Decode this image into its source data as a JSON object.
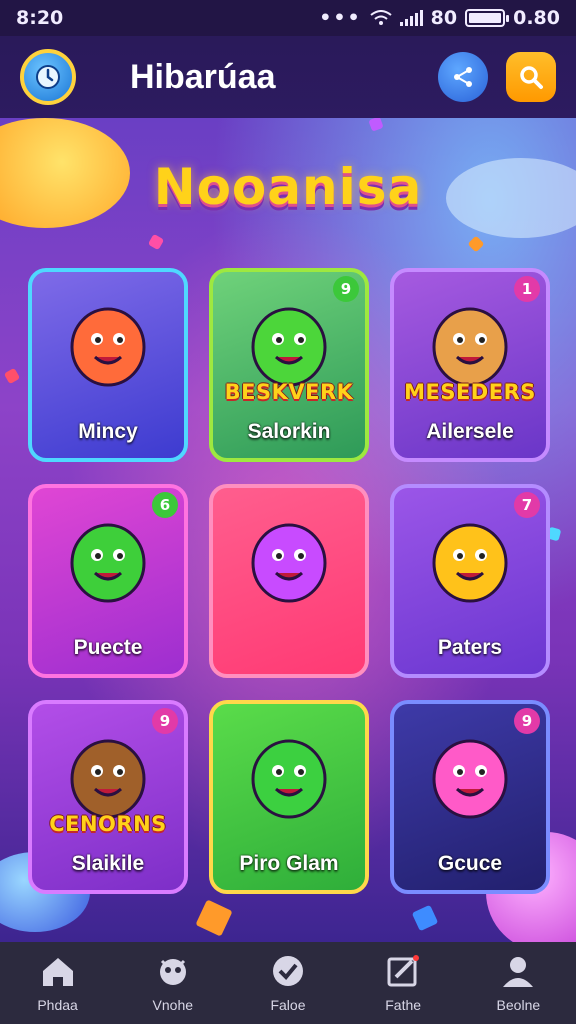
{
  "status_bar": {
    "time": "8:20",
    "signal_text": "•••",
    "network_text": "80",
    "battery_text": "0.80"
  },
  "header": {
    "title": "Hibarúaa",
    "clock_icon": "clock-icon",
    "share_icon": "share-icon",
    "search_icon": "search-icon"
  },
  "main": {
    "logo": "Nooanisa",
    "cards": [
      {
        "label": "Mincy",
        "banner": "",
        "badge": "",
        "border": "#4fd8ff",
        "bg1": "#7f6be8",
        "bg2": "#3d3bd0",
        "art": "#ff6b3a"
      },
      {
        "label": "Salorkin",
        "banner": "BESKVERK",
        "badge": "9",
        "border": "#9ee840",
        "bg1": "#6fd27a",
        "bg2": "#2e9a58",
        "art": "#4cd63a"
      },
      {
        "label": "Ailersele",
        "banner": "MESEDERS",
        "badge": "1",
        "border": "#c58bff",
        "bg1": "#a65ae0",
        "bg2": "#6a36c8",
        "art": "#e8a04a"
      },
      {
        "label": "Puecte",
        "banner": "",
        "badge": "6",
        "border": "#ff73e0",
        "bg1": "#e046d4",
        "bg2": "#9d2ed0",
        "art": "#3ecf3a"
      },
      {
        "label": "",
        "banner": "",
        "badge": "",
        "border": "#ff8fbf",
        "bg1": "#ff5e8e",
        "bg2": "#ff3a74",
        "art": "#c84bff"
      },
      {
        "label": "Paters",
        "banner": "",
        "badge": "7",
        "border": "#b48cff",
        "bg1": "#9b56e8",
        "bg2": "#6a36d0",
        "art": "#ffc21a"
      },
      {
        "label": "Slaikile",
        "banner": "CENORNS",
        "badge": "9",
        "border": "#d97bff",
        "bg1": "#b34ee8",
        "bg2": "#7d2fc8",
        "art": "#a0602a"
      },
      {
        "label": "Piro Glam",
        "banner": "",
        "badge": "",
        "border": "#ffd84a",
        "bg1": "#5adc4a",
        "bg2": "#2fae3a",
        "art": "#3cd040"
      },
      {
        "label": "Gcuce",
        "banner": "",
        "badge": "9",
        "border": "#7a8cff",
        "bg1": "#3e3aa8",
        "bg2": "#22206e",
        "art": "#ff5ac8"
      }
    ]
  },
  "bottom_nav": [
    {
      "label": "Phdaa",
      "icon": "home-icon"
    },
    {
      "label": "Vnohe",
      "icon": "monster-icon"
    },
    {
      "label": "Faloe",
      "icon": "check-badge-icon"
    },
    {
      "label": "Fathe",
      "icon": "edit-icon"
    },
    {
      "label": "Beolne",
      "icon": "profile-icon"
    }
  ],
  "colors": {
    "accent": "#ffd21a",
    "header_bg": "#2a1a5a",
    "nav_bg": "#2c2a3e"
  }
}
